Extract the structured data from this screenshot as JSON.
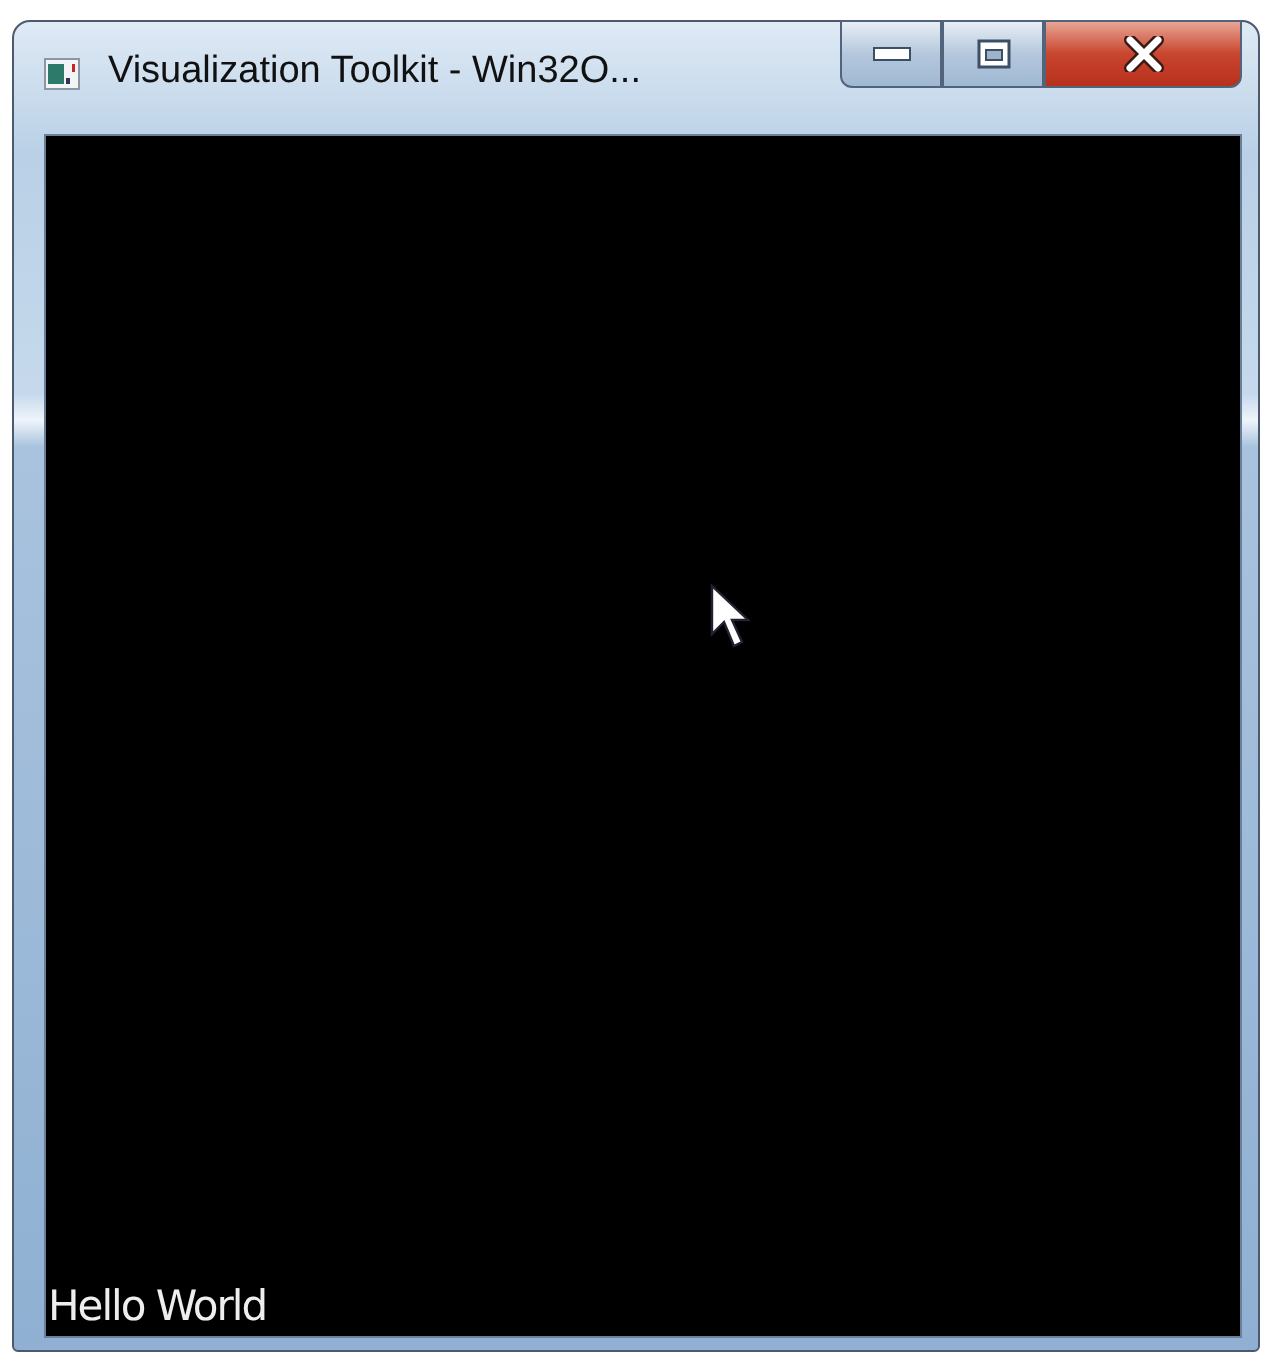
{
  "window": {
    "title": "Visualization Toolkit - Win32O..."
  },
  "viewport": {
    "text": "Hello World"
  }
}
